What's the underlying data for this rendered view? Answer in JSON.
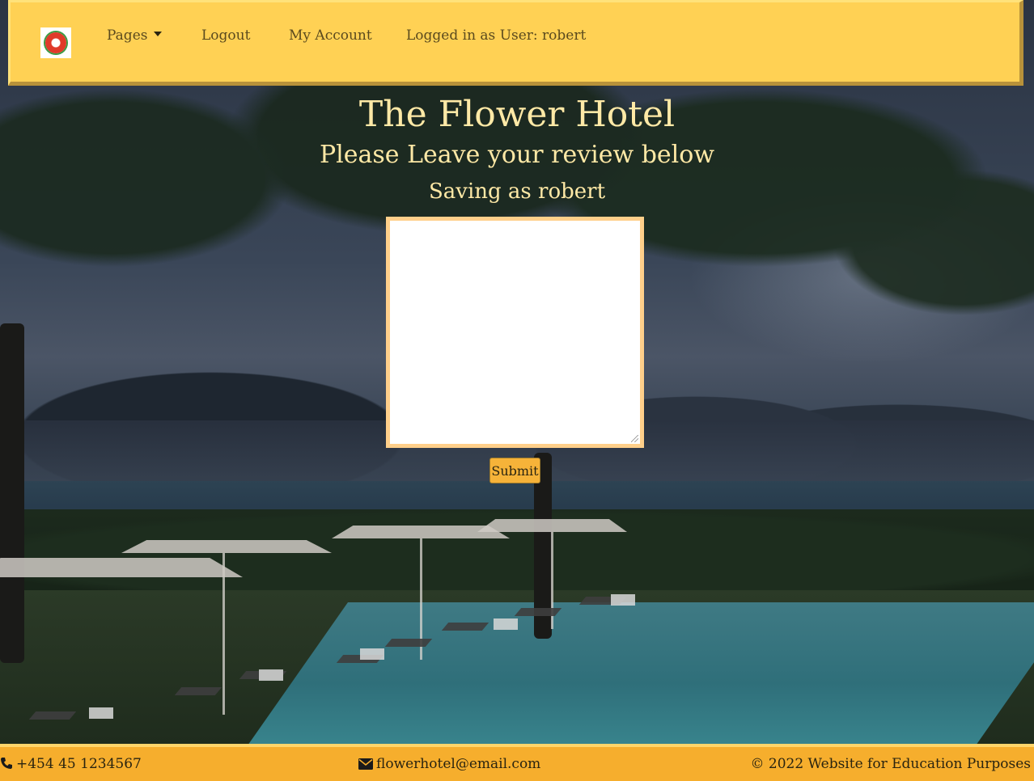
{
  "navbar": {
    "logo_alt": "flower logo",
    "pages_label": "Pages",
    "logout_label": "Logout",
    "account_label": "My Account",
    "logged_in_label": "Logged in as User: robert"
  },
  "main": {
    "title": "The Flower Hotel",
    "subtitle": "Please Leave your review below",
    "saving_text": "Saving as robert",
    "review_value": "",
    "submit_label": "Submit"
  },
  "footer": {
    "phone": "+454 45 1234567",
    "email": "flowerhotel@email.com",
    "copyright": "© 2022 Website for Education Purposes"
  },
  "colors": {
    "navbar_bg": "#ffd154",
    "footer_bg": "#f6ae2d",
    "heading_text": "#ffe9a6",
    "submit_bg": "#f6b339",
    "textarea_border": "#ffcf8a"
  },
  "icons": {
    "logo": "flower-logo-icon",
    "caret": "caret-down-icon",
    "phone": "phone-icon",
    "email": "envelope-icon"
  }
}
